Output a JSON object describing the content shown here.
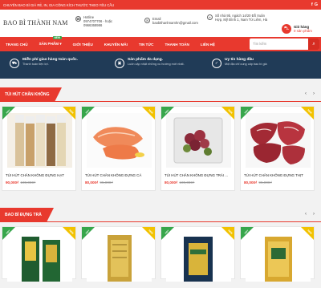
{
  "topbar": {
    "text": "CHUYÊN BAO BÌ GIÁ RẺ, IN, GIA CÔNG KÍCH THƯỚC THEO YÊU CẦU",
    "socials": [
      "f",
      "G"
    ]
  },
  "header": {
    "logo": "BAO BÌ THÀNH NAM",
    "hotline_label": "Hotline",
    "hotline_value": "0974707706 - hoặc 0966368986",
    "email_label": "Email",
    "email_value": "baobithanhnamhn@gmail.com",
    "address": "Số nhà 9b, ngách 14/20 Đỗ Xuân Hợp, Mỹ Đình 1, Nam Từ Liêm, Hà",
    "cart_title": "Giỏ hàng",
    "cart_count": "0 sản phẩm"
  },
  "nav": {
    "items": [
      "TRANG CHỦ",
      "SẢN PHẨM ▾",
      "GIỚI THIỆU",
      "KHUYẾN MÃI",
      "TIN TỨC",
      "THANH TOÁN",
      "LIÊN HỆ"
    ],
    "new_badge": "NEW",
    "search_placeholder": "Tìm kiếm"
  },
  "features": [
    {
      "title": "Miễn phí giao hàng toàn quốc.",
      "sub": "Thanh toán tiện lợi.",
      "icon": "truck-icon"
    },
    {
      "title": "Sản phẩm đa dạng.",
      "sub": "Luôn cập nhật những xu hướng mới nhất.",
      "icon": "box-icon"
    },
    {
      "title": "Uy tín hàng đầu",
      "sub": "Một địa chỉ cung cấp bao bì giá",
      "icon": "shield-icon"
    }
  ],
  "sections": [
    {
      "title": "TÚI HÚT CHÂN KHÔNG",
      "products": [
        {
          "name": "TÚI HÚT CHÂN KHÔNG ĐỰNG HẠT",
          "price": "90,000₫",
          "old": "100,000₫"
        },
        {
          "name": "TÚI HÚT CHÂN KHÔNG ĐỰNG CÁ",
          "price": "80,000₫",
          "old": "95,000₫"
        },
        {
          "name": "TÚI HÚT CHÂN KHÔNG ĐỰNG TRÁI ...",
          "price": "80,000₫",
          "old": "100,000₫"
        },
        {
          "name": "TÚI HÚT CHÂN KHÔNG ĐỰNG THỊT",
          "price": "80,000₫",
          "old": "95,000₫"
        }
      ]
    },
    {
      "title": "BAO BÌ ĐỰNG TRÀ",
      "products": []
    }
  ],
  "ribbons": {
    "left": "HOT",
    "right": "NEW"
  },
  "colors": {
    "accent": "#e8392e",
    "dark": "#203b57",
    "green": "#37a64b",
    "yellow": "#f2c200"
  }
}
